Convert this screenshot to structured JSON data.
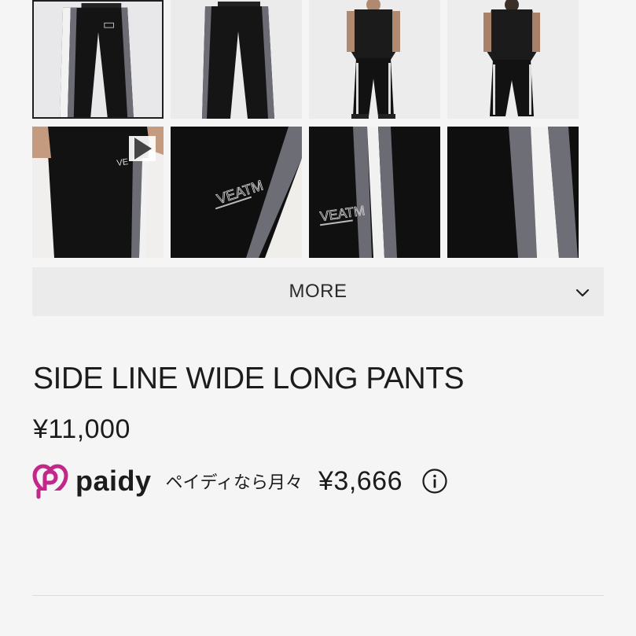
{
  "gallery": {
    "thumbnails": [
      {
        "name": "thumb-1",
        "alt": "front-flat",
        "selected": true
      },
      {
        "name": "thumb-2",
        "alt": "back-flat",
        "selected": false
      },
      {
        "name": "thumb-3",
        "alt": "model-front",
        "selected": false
      },
      {
        "name": "thumb-4",
        "alt": "model-back",
        "selected": false
      },
      {
        "name": "thumb-5",
        "alt": "model-video",
        "selected": false,
        "has_video": true
      },
      {
        "name": "thumb-6",
        "alt": "logo-detail",
        "selected": false
      },
      {
        "name": "thumb-7",
        "alt": "pocket-detail",
        "selected": false
      },
      {
        "name": "thumb-8",
        "alt": "stripe-detail",
        "selected": false
      }
    ],
    "icons": {
      "play": "play-icon"
    }
  },
  "more": {
    "label": "MORE",
    "icon": "chevron-down-icon"
  },
  "product": {
    "title": "SIDE LINE WIDE LONG PANTS",
    "price": "¥11,000"
  },
  "paidy": {
    "brand": "paidy",
    "text": "ペイディなら月々",
    "amount": "¥3,666",
    "info_icon": "info-icon",
    "brand_color": "#c4278a"
  },
  "colors": {
    "background": "#f5f5f6",
    "more_bar": "#ebebec",
    "text": "#1c1c1c"
  }
}
